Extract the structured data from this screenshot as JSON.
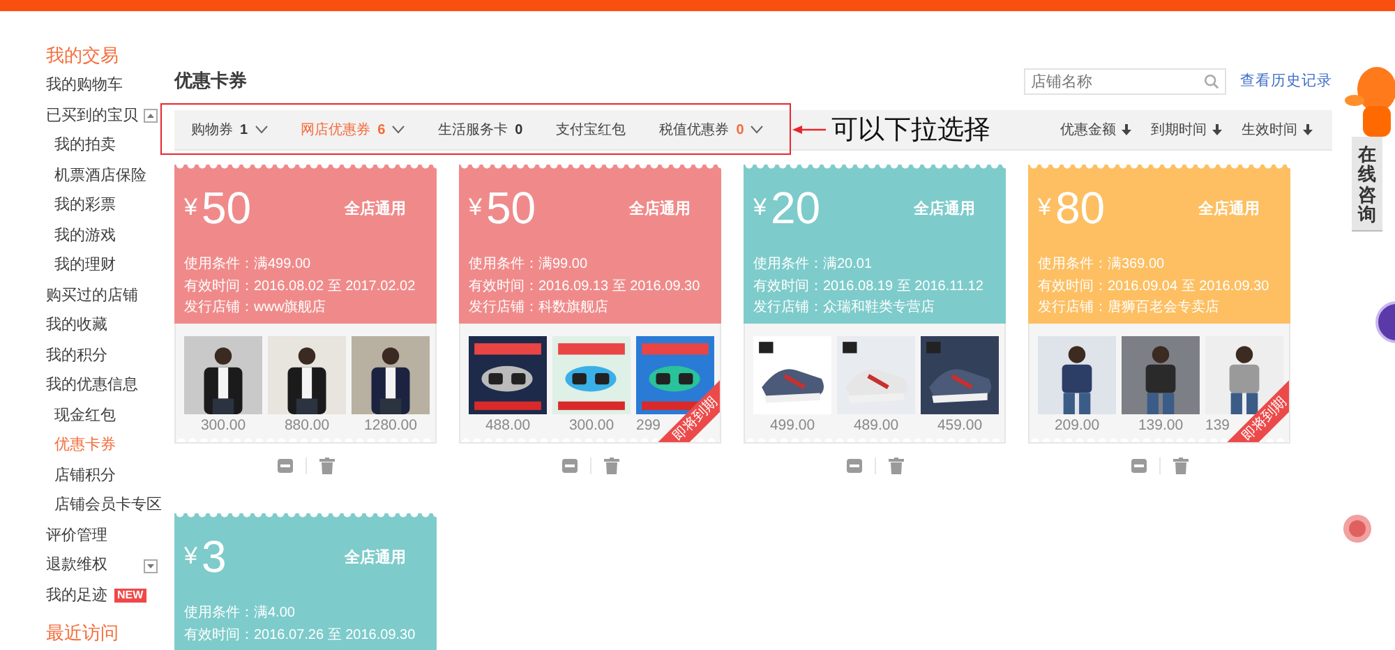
{
  "sidebar": {
    "groups": [
      {
        "heading": "我的交易",
        "items": [
          {
            "label": "我的购物车",
            "selected": false
          },
          {
            "label": "已买到的宝贝",
            "selected": false,
            "expanded": true,
            "children": [
              {
                "label": "我的拍卖",
                "selected": false
              },
              {
                "label": "机票酒店保险",
                "selected": false
              },
              {
                "label": "我的彩票",
                "selected": false
              },
              {
                "label": "我的游戏",
                "selected": false
              },
              {
                "label": "我的理财",
                "selected": false
              }
            ]
          },
          {
            "label": "购买过的店铺",
            "selected": false
          },
          {
            "label": "我的收藏",
            "selected": false
          },
          {
            "label": "我的积分",
            "selected": false
          },
          {
            "label": "我的优惠信息",
            "selected": false,
            "children": [
              {
                "label": "现金红包",
                "selected": false
              },
              {
                "label": "优惠卡券",
                "selected": true
              },
              {
                "label": "店铺积分",
                "selected": false
              },
              {
                "label": "店铺会员卡专区",
                "selected": false
              }
            ]
          },
          {
            "label": "评价管理",
            "selected": false
          },
          {
            "label": "退款维权",
            "selected": false,
            "expanded": false
          },
          {
            "label": "我的足迹",
            "selected": false,
            "badge": "NEW"
          }
        ]
      },
      {
        "heading": "最近访问"
      }
    ]
  },
  "page_title": "优惠卡券",
  "search": {
    "placeholder": "店铺名称"
  },
  "history_link": "查看历史记录",
  "filter_tabs": [
    {
      "label": "购物券",
      "count": "1",
      "dropdown": true,
      "selected": false,
      "count_highlighted": false
    },
    {
      "label": "网店优惠券",
      "count": "6",
      "dropdown": true,
      "selected": true,
      "count_highlighted": true
    },
    {
      "label": "生活服务卡",
      "count": "0",
      "dropdown": false,
      "selected": false,
      "count_highlighted": false
    },
    {
      "label": "支付宝红包",
      "dropdown": false,
      "selected": false
    },
    {
      "label": "税值优惠券",
      "count": "0",
      "dropdown": true,
      "selected": false,
      "count_highlighted": true
    }
  ],
  "annotation": {
    "text": "可以下拉选择"
  },
  "sort_options": [
    "优惠金额",
    "到期时间",
    "生效时间"
  ],
  "coupons": [
    {
      "color": "#f08a8a",
      "currency": "¥",
      "amount": "50",
      "scope": "全店通用",
      "lines": [
        "使用条件：满499.00",
        "有效时间：2016.08.02 至 2017.02.02",
        "发行店铺：www旗舰店"
      ],
      "products": [
        {
          "price": "300.00"
        },
        {
          "price": "880.00"
        },
        {
          "price": "1280.00"
        }
      ]
    },
    {
      "color": "#f08a8a",
      "currency": "¥",
      "amount": "50",
      "scope": "全店通用",
      "lines": [
        "使用条件：满99.00",
        "有效时间：2016.09.13 至 2016.09.30",
        "发行店铺：科数旗舰店"
      ],
      "products": [
        {
          "price": "488.00"
        },
        {
          "price": "300.00"
        },
        {
          "price": "299"
        }
      ],
      "expiring_label": "即将到期"
    },
    {
      "color": "#7ecbcb",
      "currency": "¥",
      "amount": "20",
      "scope": "全店通用",
      "lines": [
        "使用条件：满20.01",
        "有效时间：2016.08.19 至 2016.11.12",
        "发行店铺：众瑞和鞋类专营店"
      ],
      "products": [
        {
          "price": "499.00"
        },
        {
          "price": "489.00"
        },
        {
          "price": "459.00"
        }
      ]
    },
    {
      "color": "#fdbf62",
      "currency": "¥",
      "amount": "80",
      "scope": "全店通用",
      "lines": [
        "使用条件：满369.00",
        "有效时间：2016.09.04 至 2016.09.30",
        "发行店铺：唐狮百老会专卖店"
      ],
      "products": [
        {
          "price": "209.00"
        },
        {
          "price": "139.00"
        },
        {
          "price": "139"
        }
      ],
      "expiring_label": "即将到期"
    },
    {
      "color": "#7ecbcb",
      "currency": "¥",
      "amount": "3",
      "scope": "全店通用",
      "lines": [
        "使用条件：满4.00",
        "有效时间：2016.07.26 至 2016.09.30"
      ]
    }
  ],
  "help_tab": "在线咨询"
}
